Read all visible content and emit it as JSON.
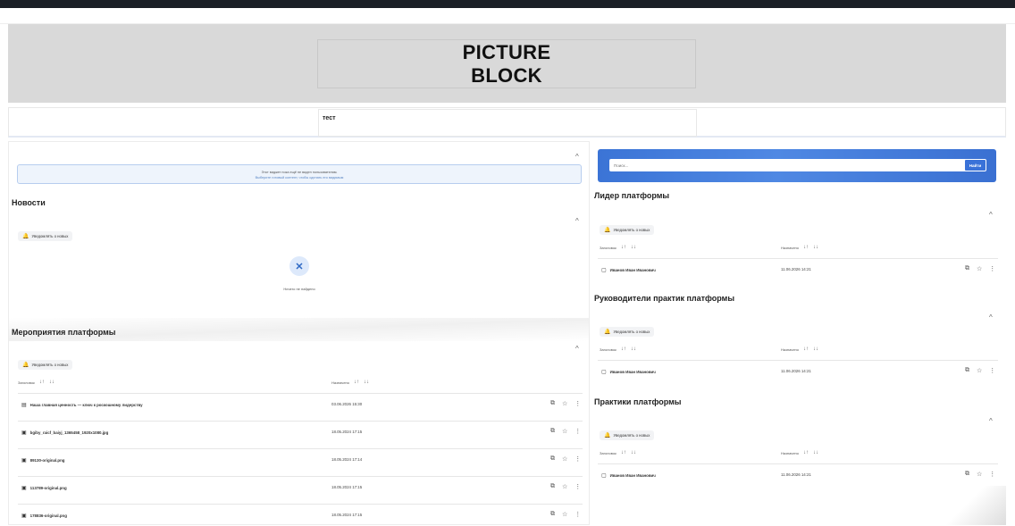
{
  "hero": {
    "title": "PICTURE\nBLOCK"
  },
  "text_widget": {
    "content": "тест"
  },
  "hidden_widget_notice": {
    "line1": "Этот виджет пока ещё не виден пользователям.",
    "line2": "Выберите готовый контент, чтобы сделать его видимым"
  },
  "common": {
    "notify_label": "Уведомлять о новых",
    "col_title": "Заголовок",
    "col_date": "Назначено",
    "sort_asc": "↓↑",
    "sort_desc": "↓↓",
    "caret": "^"
  },
  "news": {
    "title": "Новости",
    "empty_text": "Ничего не найдено"
  },
  "events": {
    "title": "Мероприятия платформы",
    "rows": [
      {
        "name": "Наша главная ценность — ключ к роскошному лидерству",
        "date": "03.06.2026 15:30",
        "icon": "document-icon"
      },
      {
        "name": "bgiby_raicf_baiyj_1365458_1920x1080.jpg",
        "date": "18.05.2024 17:15",
        "icon": "image-icon"
      },
      {
        "name": "89130-original.png",
        "date": "18.05.2024 17:14",
        "icon": "image-icon"
      },
      {
        "name": "113789-original.png",
        "date": "18.05.2024 17:15",
        "icon": "image-icon"
      },
      {
        "name": "178836-original.png",
        "date": "18.05.2024 17:15",
        "icon": "image-icon"
      }
    ]
  },
  "search": {
    "placeholder": "Поиск...",
    "button": "Найти"
  },
  "leader": {
    "title": "Лидер платформы",
    "rows": [
      {
        "name": "Иванов Иван Иванович",
        "date": "11.06.2026 14:21"
      }
    ]
  },
  "practice_heads": {
    "title": "Руководители практик платформы",
    "rows": [
      {
        "name": "Иванов Иван Иванович",
        "date": "11.06.2026 14:21"
      }
    ]
  },
  "practices": {
    "title": "Практики платформы",
    "rows": [
      {
        "name": "Иванов Иван Иванович",
        "date": "11.06.2026 14:21"
      }
    ]
  },
  "icons": {
    "bell": "🔔",
    "open": "⧉",
    "star": "☆",
    "more": "⋮",
    "search_empty": "✕",
    "doc": "▤",
    "img": "▣",
    "person": "▢"
  },
  "colors": {
    "accent": "#3b74d6",
    "hero_bg": "#d9d9d9",
    "notice_bg": "#eef4fc"
  }
}
